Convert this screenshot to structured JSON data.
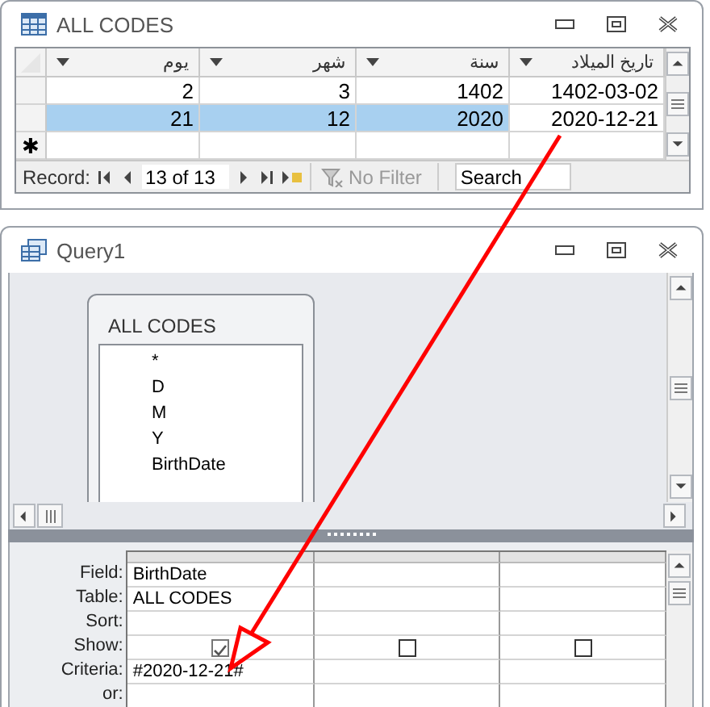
{
  "datasheet_window": {
    "title": "ALL CODES",
    "columns": [
      "يوم",
      "شهر",
      "سنة",
      "تاريخ الميلاد"
    ],
    "rows": [
      {
        "selected": false,
        "cells": [
          "2",
          "3",
          "1402",
          "1402-03-02"
        ]
      },
      {
        "selected": true,
        "cells": [
          "21",
          "12",
          "2020",
          "2020-12-21"
        ]
      }
    ],
    "new_row_symbol": "✱",
    "navigation": {
      "label": "Record:",
      "position": "13 of 13",
      "filter": "No Filter",
      "search_placeholder": "Search"
    }
  },
  "query_window": {
    "title": "Query1",
    "table": {
      "title": "ALL CODES",
      "fields": [
        "*",
        "D",
        "M",
        "Y",
        "BirthDate"
      ]
    },
    "row_labels": [
      "Field:",
      "Table:",
      "Sort:",
      "Show:",
      "Criteria:",
      "or:"
    ],
    "columns": [
      {
        "field": "BirthDate",
        "table": "ALL CODES",
        "show": true,
        "criteria": "#2020-12-21#"
      },
      {
        "show": false
      },
      {
        "show": false
      }
    ]
  }
}
